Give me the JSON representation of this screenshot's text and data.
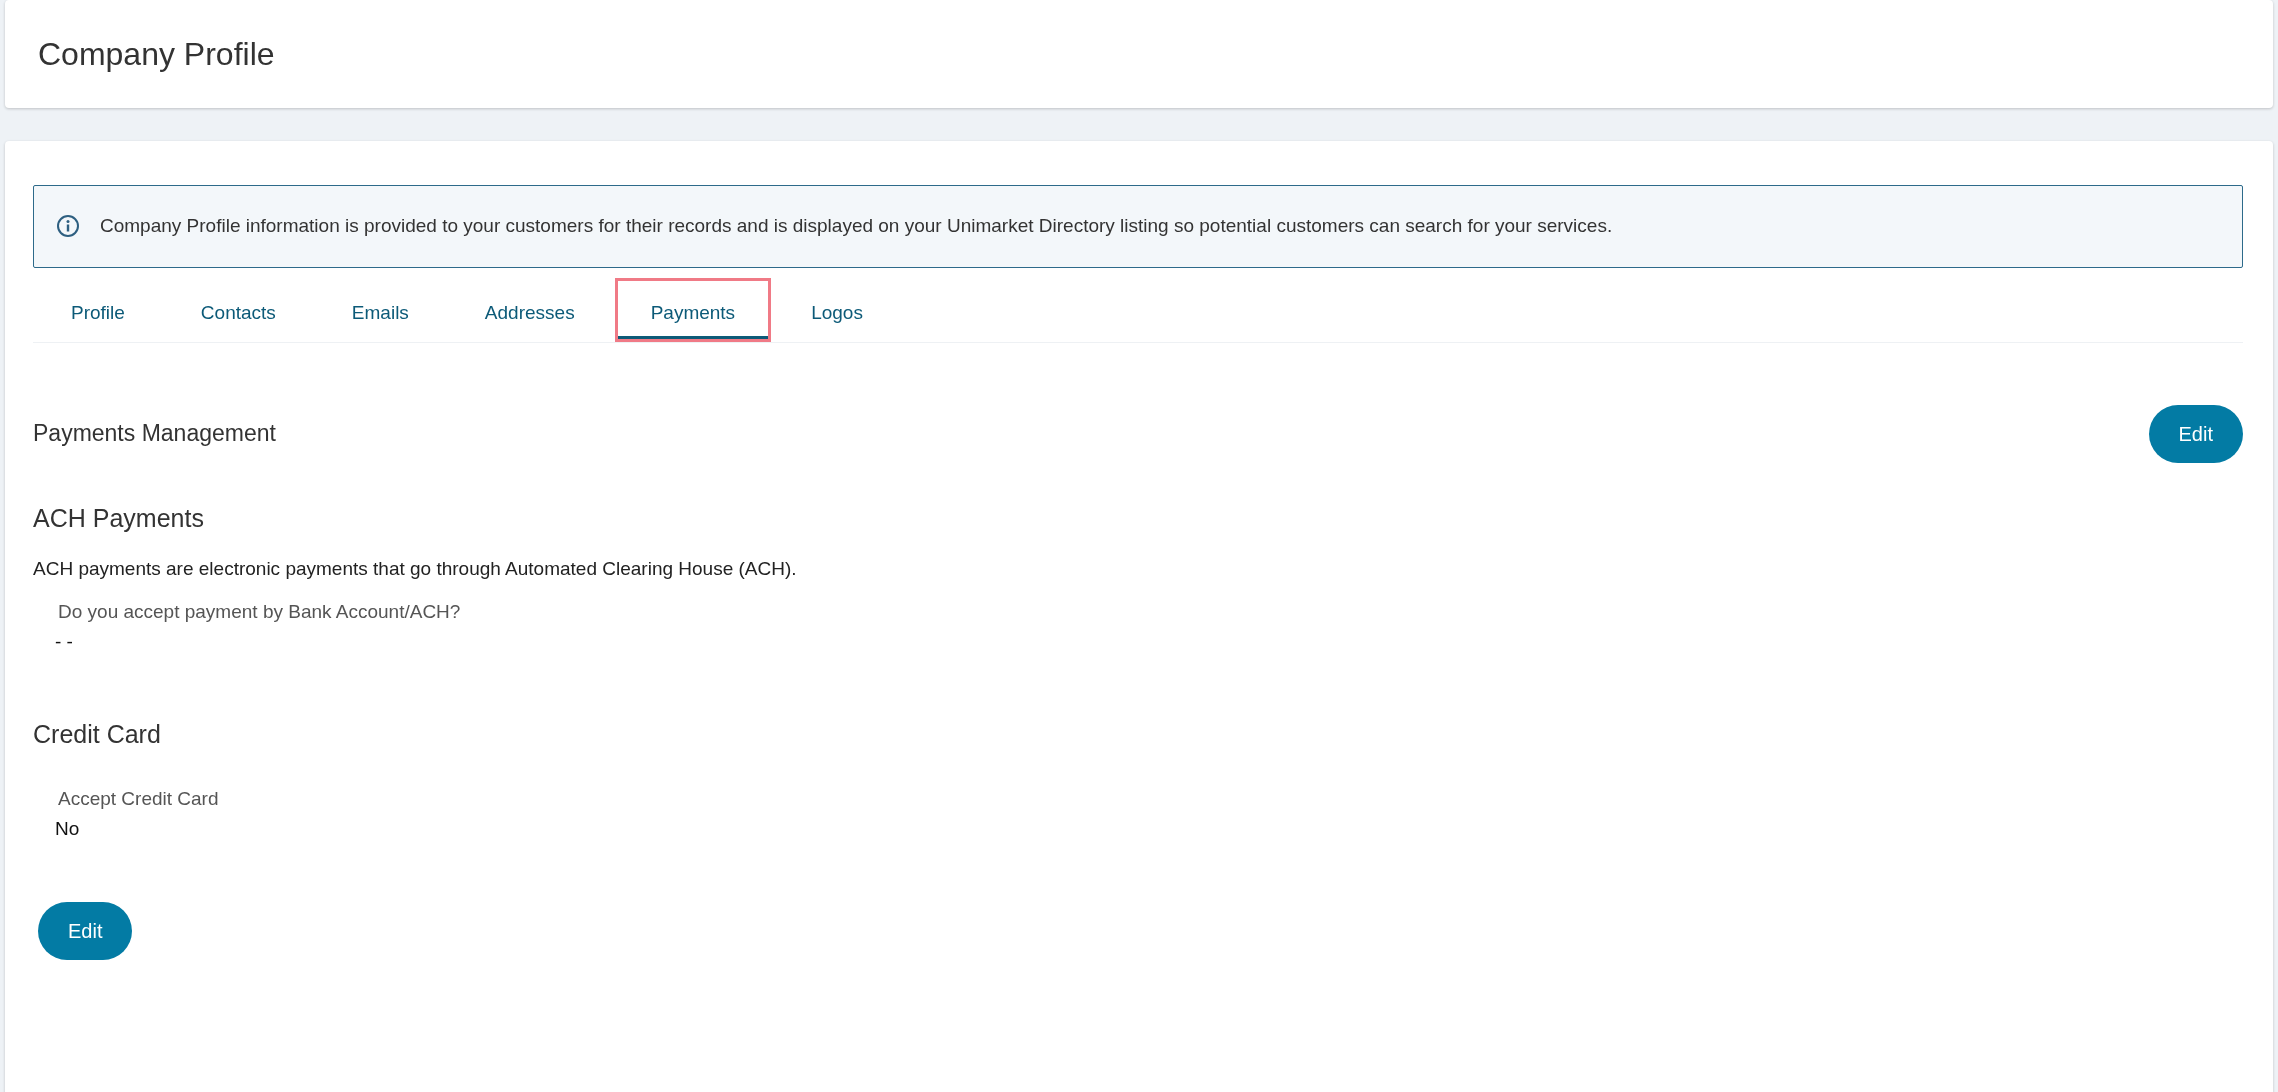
{
  "page": {
    "title": "Company Profile"
  },
  "info_banner": {
    "text": "Company Profile information is provided to your customers for their records and is displayed on your Unimarket Directory listing so potential customers can search for your services."
  },
  "tabs": [
    {
      "label": "Profile",
      "selected": false,
      "highlighted": false
    },
    {
      "label": "Contacts",
      "selected": false,
      "highlighted": false
    },
    {
      "label": "Emails",
      "selected": false,
      "highlighted": false
    },
    {
      "label": "Addresses",
      "selected": false,
      "highlighted": false
    },
    {
      "label": "Payments",
      "selected": true,
      "highlighted": true
    },
    {
      "label": "Logos",
      "selected": false,
      "highlighted": false
    }
  ],
  "section": {
    "title": "Payments Management",
    "edit_button": "Edit"
  },
  "groups": [
    {
      "title": "ACH Payments",
      "description": "ACH payments are electronic payments that go through Automated Clearing House (ACH).",
      "field_label": "Do you accept payment by Bank Account/ACH?",
      "field_value": "- -"
    },
    {
      "title": "Credit Card",
      "field_label": "Accept Credit Card",
      "field_value": "No"
    }
  ],
  "bottom_button": "Edit"
}
